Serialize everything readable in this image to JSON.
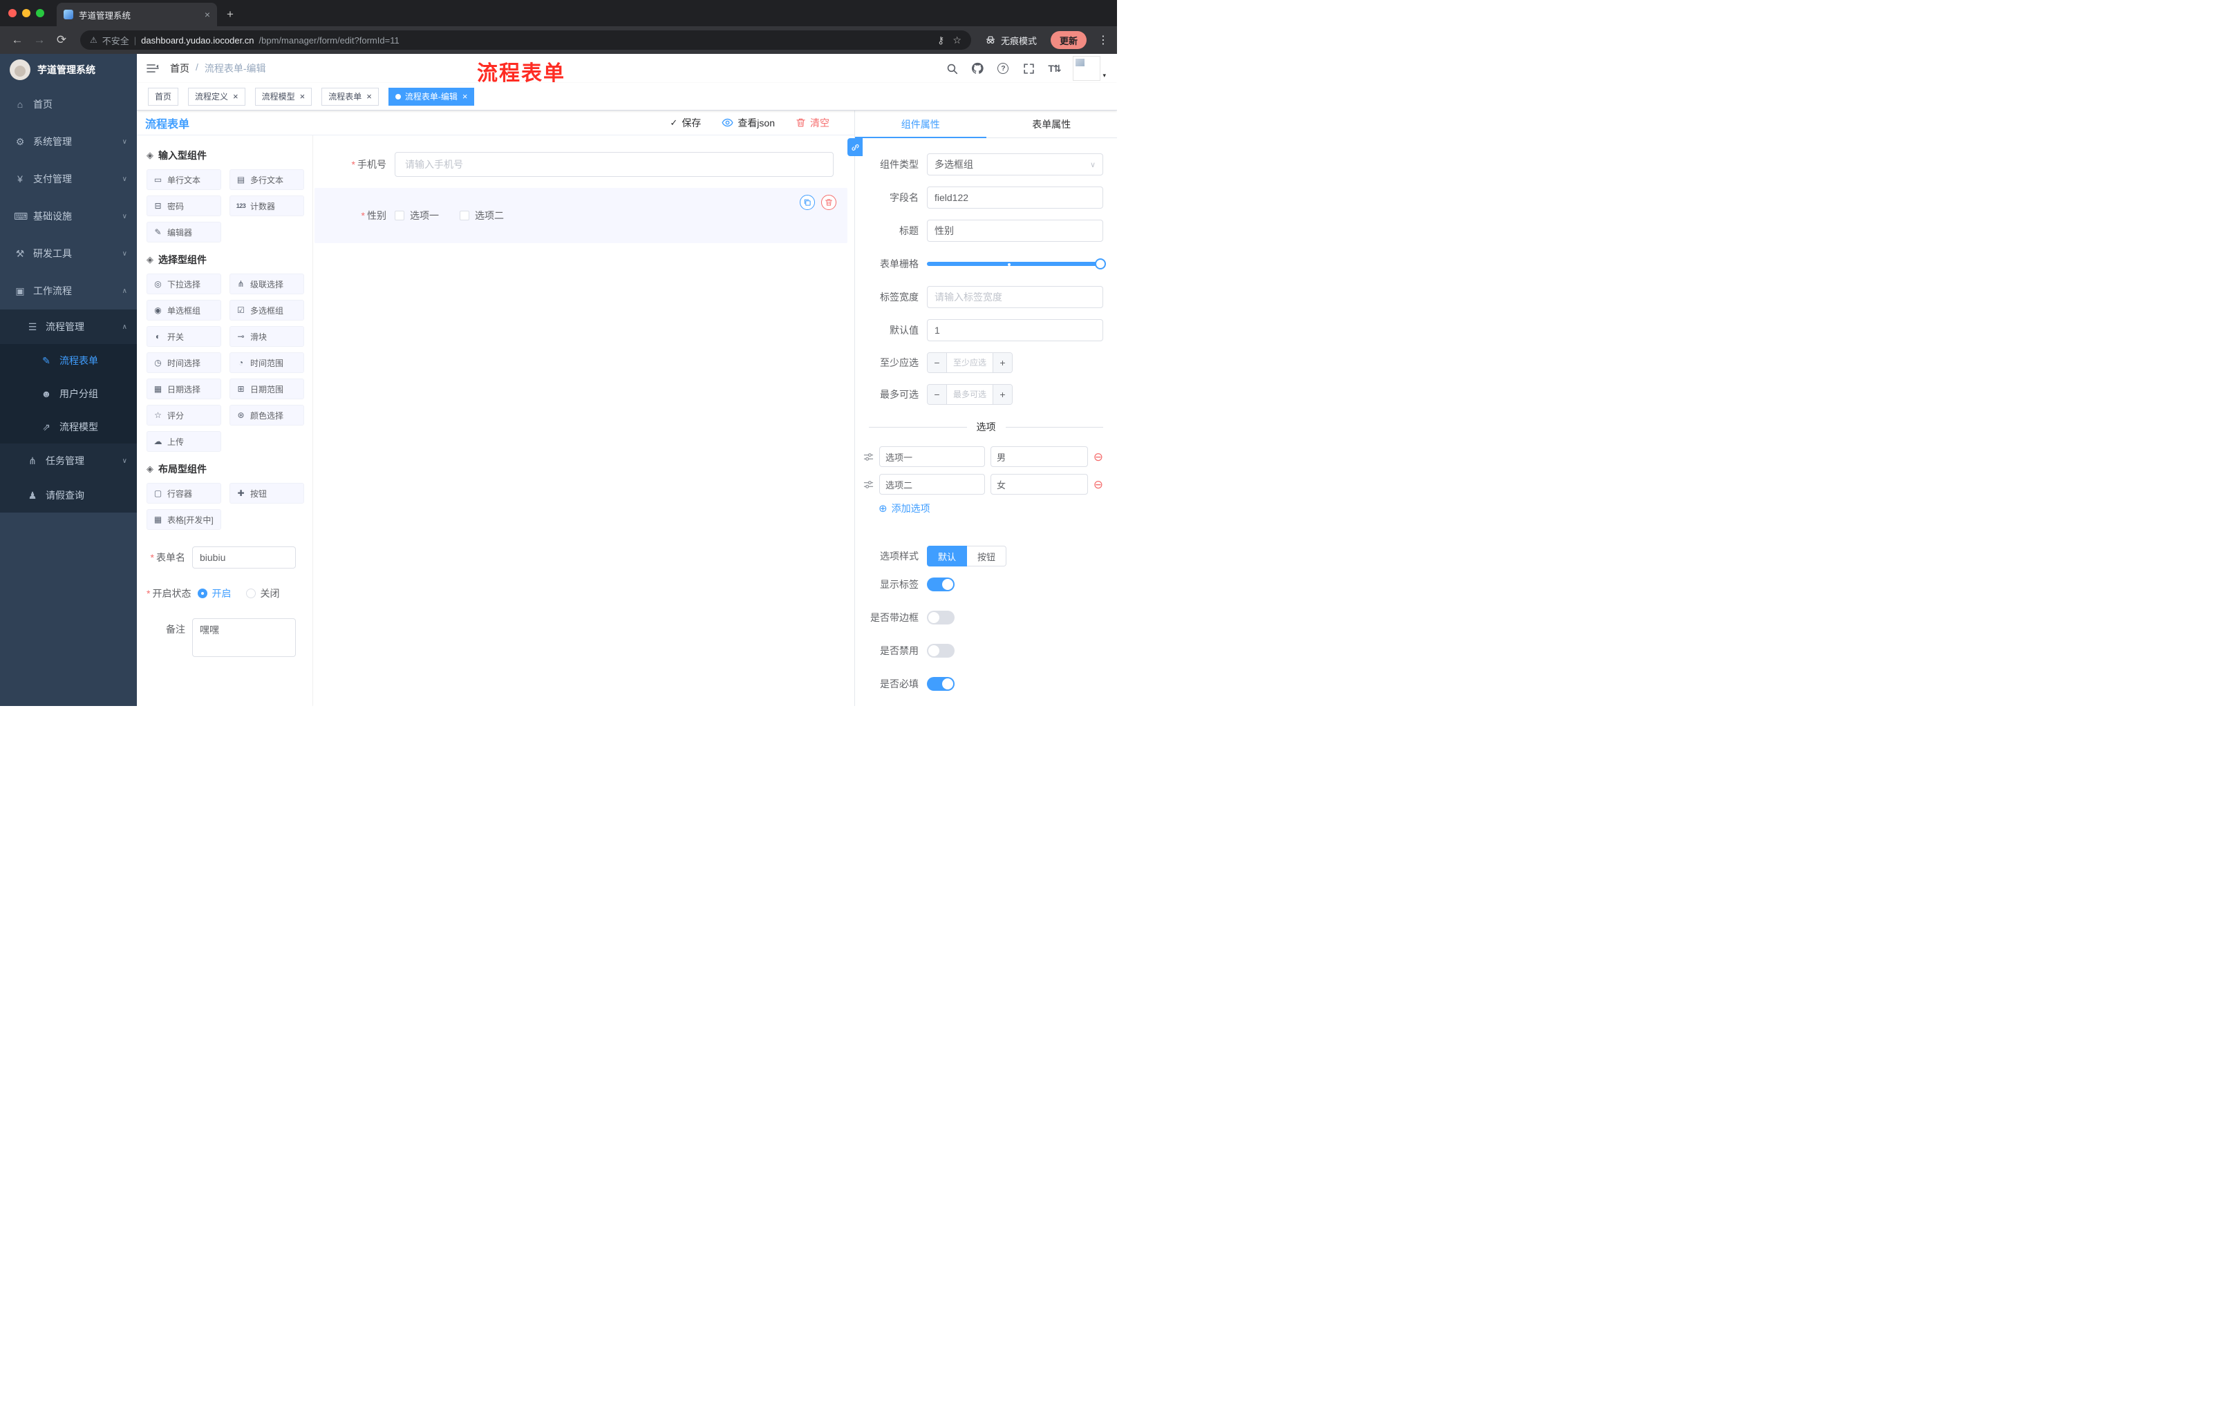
{
  "icons": {
    "back": "←",
    "forward": "→",
    "reload": "⟳",
    "warning": "⚠",
    "divider": "|",
    "key": "⚷",
    "star": "☆",
    "menu_dots": "⋮",
    "close": "×",
    "plus": "+",
    "chevron_down": "∨",
    "chevron_up": "∧",
    "select_caret": "∨",
    "caret_down": "▾",
    "section": "◈",
    "check": "✓",
    "help": "?",
    "font_size": "T⇅",
    "remove_circle": "⊖",
    "add_circle": "⊕",
    "minus": "−",
    "plus_sign": "+"
  },
  "chrome": {
    "tab": {
      "title": "芋道管理系统"
    },
    "address": {
      "security_label": "不安全",
      "url_domain": "dashboard.yudao.iocoder.cn",
      "url_path": "/bpm/manager/form/edit?formId=11",
      "incognito_label": "无痕模式",
      "update_label": "更新"
    }
  },
  "sidebar": {
    "app_title": "芋道管理系统",
    "menu": [
      {
        "label": "首页",
        "icon": "⌂"
      },
      {
        "label": "系统管理",
        "icon": "⚙",
        "chevron": "∨"
      },
      {
        "label": "支付管理",
        "icon": "¥",
        "chevron": "∨"
      },
      {
        "label": "基础设施",
        "icon": "⌨",
        "chevron": "∨"
      },
      {
        "label": "研发工具",
        "icon": "⚒",
        "chevron": "∨"
      },
      {
        "label": "工作流程",
        "icon": "▣",
        "chevron": "∧"
      },
      {
        "label": "流程管理",
        "icon": "☰",
        "chevron": "∧"
      },
      {
        "label": "流程表单",
        "icon": "✎"
      },
      {
        "label": "用户分组",
        "icon": "☻"
      },
      {
        "label": "流程模型",
        "icon": "⇗"
      },
      {
        "label": "任务管理",
        "icon": "⋔",
        "chevron": "∨"
      },
      {
        "label": "请假查询",
        "icon": "♟"
      }
    ]
  },
  "header": {
    "breadcrumb": {
      "home": "首页",
      "separator": "/",
      "current": "流程表单-编辑"
    },
    "annotation": "流程表单"
  },
  "tags": [
    {
      "label": "首页"
    },
    {
      "label": "流程定义"
    },
    {
      "label": "流程模型"
    },
    {
      "label": "流程表单"
    },
    {
      "label": "流程表单-编辑"
    }
  ],
  "designer": {
    "title": "流程表单",
    "required_marker": "*",
    "toolbar": {
      "save": "保存",
      "view_json": "查看json",
      "clear": "清空"
    },
    "palette": {
      "sections": [
        {
          "title": "输入型组件",
          "items": [
            {
              "label": "单行文本",
              "icon": "▭"
            },
            {
              "label": "多行文本",
              "icon": "▤"
            },
            {
              "label": "密码",
              "icon": "⊟"
            },
            {
              "label": "计数器",
              "icon": "123"
            },
            {
              "label": "编辑器",
              "icon": "✎"
            }
          ]
        },
        {
          "title": "选择型组件",
          "items": [
            {
              "label": "下拉选择",
              "icon": "◎"
            },
            {
              "label": "级联选择",
              "icon": "⋔"
            },
            {
              "label": "单选框组",
              "icon": "◉"
            },
            {
              "label": "多选框组",
              "icon": "☑"
            },
            {
              "label": "开关",
              "icon": "◐"
            },
            {
              "label": "滑块",
              "icon": "⊸"
            },
            {
              "label": "时间选择",
              "icon": "◷"
            },
            {
              "label": "时间范围",
              "icon": "◔"
            },
            {
              "label": "日期选择",
              "icon": "▦"
            },
            {
              "label": "日期范围",
              "icon": "⊞"
            },
            {
              "label": "评分",
              "icon": "☆"
            },
            {
              "label": "颜色选择",
              "icon": "⊛"
            },
            {
              "label": "上传",
              "icon": "☁"
            }
          ]
        },
        {
          "title": "布局型组件",
          "items": [
            {
              "label": "行容器",
              "icon": "▢"
            },
            {
              "label": "按钮",
              "icon": "✚"
            },
            {
              "label": "表格[开发中]",
              "icon": "▦"
            }
          ]
        }
      ],
      "settings": {
        "form_name_label": "表单名",
        "form_name_value": "biubiu",
        "status_label": "开启状态",
        "status_on": "开启",
        "status_off": "关闭",
        "remark_label": "备注",
        "remark_value": "嘿嘿"
      }
    },
    "canvas": {
      "phone_label": "手机号",
      "phone_placeholder": "请输入手机号",
      "gender_label": "性别",
      "gender_option_1": "选项一",
      "gender_option_2": "选项二"
    },
    "properties": {
      "tab_component": "组件属性",
      "tab_form": "表单属性",
      "component_type_label": "组件类型",
      "component_type_value": "多选框组",
      "field_name_label": "字段名",
      "field_name_value": "field122",
      "title_label": "标题",
      "title_value": "性别",
      "grid_label": "表单栅格",
      "label_width_label": "标签宽度",
      "label_width_placeholder": "请输入标签宽度",
      "default_label": "默认值",
      "default_value": "1",
      "min_label": "至少应选",
      "min_placeholder": "至少应选",
      "max_label": "最多可选",
      "max_placeholder": "最多可选",
      "options_divider": "选项",
      "options": [
        {
          "label": "选项一",
          "value": "男"
        },
        {
          "label": "选项二",
          "value": "女"
        }
      ],
      "add_option": "添加选项",
      "option_style_label": "选项样式",
      "option_style_default": "默认",
      "option_style_button": "按钮",
      "show_label_label": "显示标签",
      "border_label": "是否带边框",
      "disabled_label": "是否禁用",
      "required_label": "是否必填"
    }
  }
}
